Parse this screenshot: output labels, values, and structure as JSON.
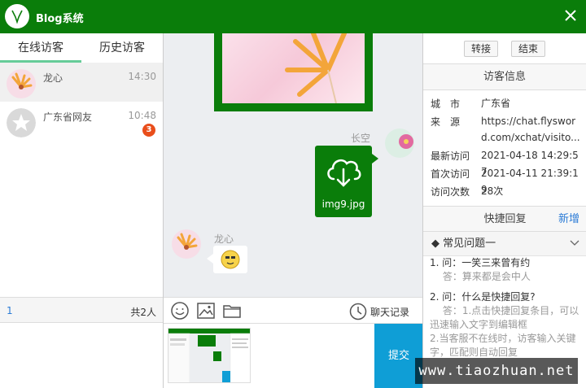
{
  "app": {
    "title": "Blog系统"
  },
  "left": {
    "tabs": [
      {
        "label": "在线访客"
      },
      {
        "label": "历史访客"
      }
    ],
    "visitors": [
      {
        "name": "龙心",
        "time": "14:30"
      },
      {
        "name": "广东省网友",
        "time": "10:48",
        "badge": "3"
      }
    ],
    "footer": {
      "page": "1",
      "count": "共2人"
    }
  },
  "chat": {
    "file_sender": "长空",
    "file_name": "img9.jpg",
    "emoji_sender": "龙心"
  },
  "toolbar": {
    "icons": [
      "emoji-icon",
      "image-icon",
      "folder-icon",
      "clock-icon"
    ],
    "history_label": "聊天记录"
  },
  "composer": {
    "submit_label": "提交"
  },
  "right": {
    "buttons": {
      "transfer": "转接",
      "end": "结束"
    },
    "visitor_info_title": "访客信息",
    "info": [
      {
        "key": "城　市",
        "value": "广东省"
      },
      {
        "key": "来　源",
        "value": "https://chat.flysword.com/xchat/visito..."
      },
      {
        "key": "最新访问",
        "value": "2021-04-18 14:29:57"
      },
      {
        "key": "首次访问",
        "value": "2021-04-11 21:39:19"
      },
      {
        "key": "访问次数",
        "value": "28次"
      }
    ],
    "quick_reply": {
      "title": "快捷回复",
      "add_label": "新增"
    },
    "faq_group": "常见问题一",
    "faq": [
      {
        "q": "1. 问：一笑三来曾有约",
        "a": "　 答：算来都是会中人"
      },
      {
        "q": "2. 问：什么是快捷回复?",
        "a": "　 答：1.点击快捷回复条目，可以迅速输入文字到编辑框\n2.当客服不在线时，访客输入关键字，匹配则自动回复"
      }
    ]
  },
  "watermark": "www.tiaozhuan.net",
  "colors": {
    "brand": "#0a7d0a",
    "submit": "#0f9ed6",
    "badge": "#e94e1b",
    "link": "#2b7bd6"
  }
}
